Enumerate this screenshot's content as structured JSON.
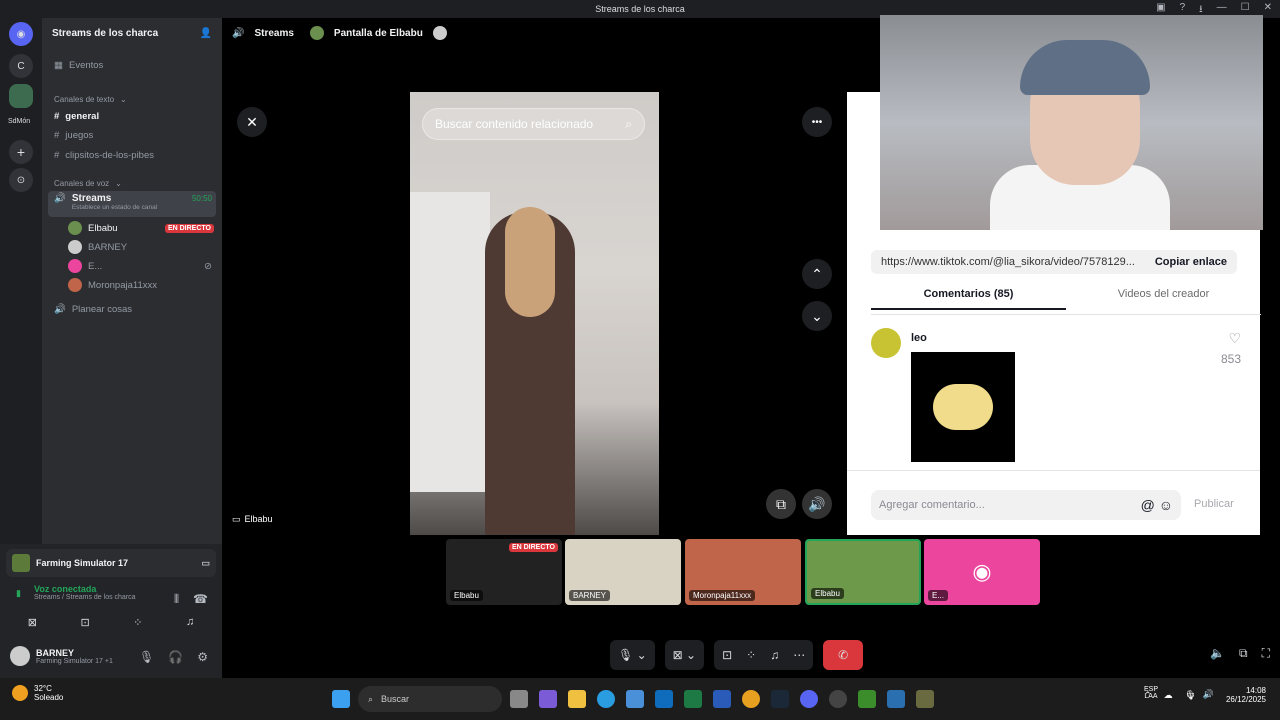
{
  "window": {
    "title": "Streams de los charca"
  },
  "servers": {
    "letter_c": "C",
    "label_sdmon": "SdMón"
  },
  "sidebar": {
    "server_name": "Streams de los charca",
    "events": "Eventos",
    "text_category": "Canales de texto",
    "text_channels": [
      "general",
      "juegos",
      "clipsitos-de-los-pibes"
    ],
    "voice_category": "Canales de voz",
    "voice_channel": {
      "name": "Streams",
      "timer": "50:50",
      "status": "Establece un estado de canal"
    },
    "voice_members": [
      {
        "name": "Elbabu",
        "badge": "EN DIRECTO"
      },
      {
        "name": "BARNEY"
      },
      {
        "name": "E..."
      },
      {
        "name": "Moronpaja11xxx"
      }
    ],
    "other_voice": "Planear cosas"
  },
  "activity": {
    "game": "Farming Simulator 17"
  },
  "voice_status": {
    "title": "Voz conectada",
    "subtitle": "Streams / Streams de los charca"
  },
  "user": {
    "name": "BARNEY",
    "status": "Farming Simulator 17 +1"
  },
  "stage": {
    "channel": "Streams",
    "screen_share": "Pantalla de Elbabu",
    "streamer_label": "Elbabu"
  },
  "tiktok": {
    "search_placeholder": "Buscar contenido relacionado",
    "url": "https://www.tiktok.com/@lia_sikora/video/7578129...",
    "copy_link": "Copiar enlace",
    "tabs": [
      "Comentarios (85)",
      "Videos del creador"
    ],
    "comment": {
      "user": "leo",
      "likes": "853"
    },
    "comment_placeholder": "Agregar comentario...",
    "publish": "Publicar"
  },
  "thumbnails": [
    {
      "label": "Elbabu",
      "badge": "EN DIRECTO"
    },
    {
      "label": "BARNEY"
    },
    {
      "label": "Moronpaja11xxx"
    },
    {
      "label": "Elbabu"
    },
    {
      "label": "E..."
    }
  ],
  "taskbar": {
    "weather_temp": "32°C",
    "weather_desc": "Soleado",
    "search": "Buscar",
    "lang": "ESP",
    "lang2": "LAA",
    "time": "14:08",
    "date": "26/12/2025"
  },
  "colors": {
    "discord_bg": "#2b2d31",
    "live_red": "#da373c",
    "green": "#23a55a",
    "discord_blurple": "#5865f2"
  }
}
